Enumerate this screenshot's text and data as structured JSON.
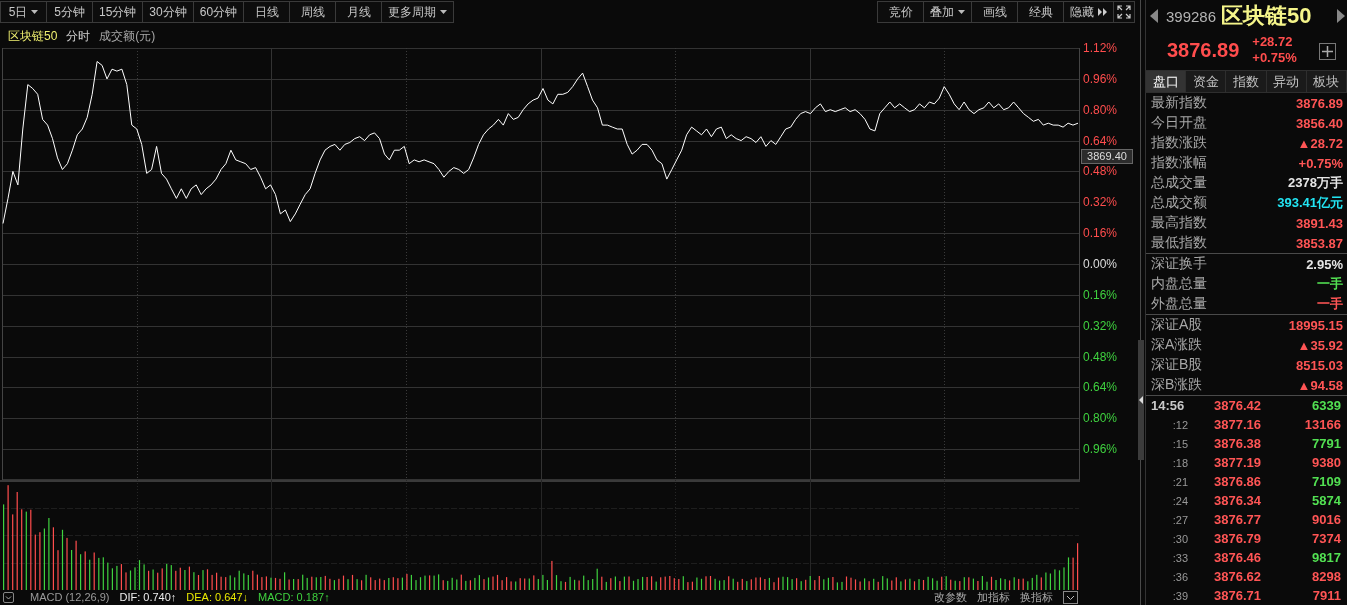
{
  "toolbar_left": [
    {
      "label": "5日",
      "kind": "dropdown",
      "selected": false
    },
    {
      "label": "5分钟",
      "kind": "button",
      "selected": false
    },
    {
      "label": "15分钟",
      "kind": "button",
      "selected": false
    },
    {
      "label": "30分钟",
      "kind": "button",
      "selected": false
    },
    {
      "label": "60分钟",
      "kind": "button",
      "selected": false
    },
    {
      "label": "日线",
      "kind": "button",
      "selected": false
    },
    {
      "label": "周线",
      "kind": "button",
      "selected": false
    },
    {
      "label": "月线",
      "kind": "button",
      "selected": false
    },
    {
      "label": "更多周期",
      "kind": "dropdown",
      "selected": false
    }
  ],
  "toolbar_right": [
    {
      "label": "竞价",
      "kind": "button"
    },
    {
      "label": "叠加",
      "kind": "dropdown"
    },
    {
      "label": "画线",
      "kind": "button"
    },
    {
      "label": "经典",
      "kind": "button"
    },
    {
      "label": "隐藏",
      "kind": "collapse"
    },
    {
      "kind": "fullscreen"
    }
  ],
  "legend": {
    "name": "区块链50",
    "period": "分时",
    "measure": "成交额(元)"
  },
  "chart": {
    "price_marker": "3869.40",
    "chart_data": {
      "type": "line",
      "grid": true,
      "ylim": [
        -1.12,
        1.12
      ],
      "yticks": [
        {
          "value": 1.12,
          "label": "1.12%"
        },
        {
          "value": 0.96,
          "label": "0.96%"
        },
        {
          "value": 0.8,
          "label": "0.80%"
        },
        {
          "value": 0.64,
          "label": "0.64%"
        },
        {
          "value": 0.48,
          "label": "0.48%"
        },
        {
          "value": 0.32,
          "label": "0.32%"
        },
        {
          "value": 0.16,
          "label": "0.16%"
        },
        {
          "value": 0,
          "label": "0.00%"
        },
        {
          "value": -0.16,
          "label": "0.16%"
        },
        {
          "value": -0.32,
          "label": "0.32%"
        },
        {
          "value": -0.48,
          "label": "0.48%"
        },
        {
          "value": -0.64,
          "label": "0.64%"
        },
        {
          "value": -0.8,
          "label": "0.80%"
        },
        {
          "value": -0.96,
          "label": "0.96%"
        }
      ],
      "values": [
        0.21,
        0.34,
        0.48,
        0.41,
        0.7,
        0.93,
        0.91,
        0.88,
        0.75,
        0.72,
        0.65,
        0.55,
        0.49,
        0.52,
        0.59,
        0.67,
        0.7,
        0.76,
        0.88,
        1.05,
        1.03,
        0.96,
        1.01,
        1.0,
        1.01,
        0.93,
        0.72,
        0.7,
        0.62,
        0.47,
        0.49,
        0.61,
        0.47,
        0.44,
        0.39,
        0.34,
        0.39,
        0.34,
        0.39,
        0.41,
        0.36,
        0.39,
        0.41,
        0.44,
        0.49,
        0.52,
        0.59,
        0.54,
        0.53,
        0.52,
        0.49,
        0.5,
        0.45,
        0.39,
        0.41,
        0.36,
        0.26,
        0.28,
        0.22,
        0.26,
        0.31,
        0.36,
        0.39,
        0.47,
        0.54,
        0.59,
        0.61,
        0.62,
        0.59,
        0.62,
        0.63,
        0.65,
        0.66,
        0.64,
        0.67,
        0.68,
        0.65,
        0.57,
        0.54,
        0.59,
        0.59,
        0.61,
        0.52,
        0.54,
        0.53,
        0.54,
        0.53,
        0.52,
        0.49,
        0.45,
        0.48,
        0.5,
        0.49,
        0.47,
        0.49,
        0.55,
        0.62,
        0.67,
        0.7,
        0.72,
        0.75,
        0.72,
        0.78,
        0.75,
        0.76,
        0.8,
        0.83,
        0.85,
        0.86,
        0.91,
        0.85,
        0.83,
        0.88,
        0.88,
        0.89,
        0.92,
        0.96,
        0.99,
        0.92,
        0.85,
        0.81,
        0.72,
        0.72,
        0.71,
        0.7,
        0.7,
        0.62,
        0.57,
        0.59,
        0.62,
        0.62,
        0.59,
        0.54,
        0.52,
        0.44,
        0.49,
        0.54,
        0.59,
        0.67,
        0.71,
        0.69,
        0.67,
        0.7,
        0.66,
        0.7,
        0.71,
        0.65,
        0.67,
        0.65,
        0.64,
        0.66,
        0.65,
        0.63,
        0.66,
        0.61,
        0.64,
        0.62,
        0.66,
        0.7,
        0.71,
        0.75,
        0.78,
        0.79,
        0.78,
        0.81,
        0.83,
        0.79,
        0.8,
        0.79,
        0.8,
        0.81,
        0.79,
        0.8,
        0.78,
        0.75,
        0.7,
        0.69,
        0.78,
        0.81,
        0.84,
        0.81,
        0.83,
        0.81,
        0.79,
        0.8,
        0.83,
        0.81,
        0.84,
        0.83,
        0.86,
        0.92,
        0.88,
        0.83,
        0.8,
        0.84,
        0.8,
        0.78,
        0.8,
        0.81,
        0.84,
        0.81,
        0.83,
        0.8,
        0.81,
        0.84,
        0.81,
        0.78,
        0.76,
        0.74,
        0.75,
        0.72,
        0.73,
        0.72,
        0.72,
        0.71,
        0.73,
        0.72,
        0.73
      ]
    }
  },
  "indicator_bar": {
    "name": "MACD (12,26,9)",
    "dif": "DIF: 0.740↑",
    "dea": "DEA: 0.647↓",
    "macd": "MACD: 0.187↑",
    "actions": [
      "改参数",
      "加指标",
      "换指标"
    ]
  },
  "quote": {
    "code": "399286",
    "name": "区块链50",
    "price": "3876.89",
    "change": "+28.72",
    "change_pct": "+0.75%"
  },
  "tabs": [
    {
      "label": "盘口",
      "selected": true
    },
    {
      "label": "资金",
      "selected": false
    },
    {
      "label": "指数",
      "selected": false
    },
    {
      "label": "异动",
      "selected": false
    },
    {
      "label": "板块",
      "selected": false
    }
  ],
  "stat_groups": [
    [
      {
        "label": "最新指数",
        "value": "3876.89",
        "color": "#ff5555"
      },
      {
        "label": "今日开盘",
        "value": "3856.40",
        "color": "#ff5555"
      },
      {
        "label": "指数涨跌",
        "value": "▲28.72",
        "color": "#ff5555"
      },
      {
        "label": "指数涨幅",
        "value": "+0.75%",
        "color": "#ff5555"
      },
      {
        "label": "总成交量",
        "value": "2378万手",
        "color": "#e6e6e6"
      },
      {
        "label": "总成交额",
        "value": "393.41亿元",
        "color": "#22e4f2"
      },
      {
        "label": "最高指数",
        "value": "3891.43",
        "color": "#ff5555"
      },
      {
        "label": "最低指数",
        "value": "3853.87",
        "color": "#ff5555"
      }
    ],
    [
      {
        "label": "深证换手",
        "value": "2.95%",
        "color": "#e6e6e6"
      },
      {
        "label": "内盘总量",
        "value": "一手",
        "color": "#52e052"
      },
      {
        "label": "外盘总量",
        "value": "一手",
        "color": "#ff5555"
      }
    ],
    [
      {
        "label": "深证A股",
        "value": "18995.15",
        "color": "#ff5555"
      },
      {
        "label": "深A涨跌",
        "value": "▲35.92",
        "color": "#ff5555"
      },
      {
        "label": "深证B股",
        "value": "8515.03",
        "color": "#ff5555"
      },
      {
        "label": "深B涨跌",
        "value": "▲94.58",
        "color": "#ff5555"
      }
    ]
  ],
  "ticks": [
    {
      "time": "14:56",
      "kind": "minute",
      "price": "3876.42",
      "volume": "6339",
      "color": "#52e052"
    },
    {
      "time": ":12",
      "kind": "second",
      "price": "3877.16",
      "volume": "13166",
      "color": "#ff5555"
    },
    {
      "time": ":15",
      "kind": "second",
      "price": "3876.38",
      "volume": "7791",
      "color": "#52e052"
    },
    {
      "time": ":18",
      "kind": "second",
      "price": "3877.19",
      "volume": "9380",
      "color": "#ff5555"
    },
    {
      "time": ":21",
      "kind": "second",
      "price": "3876.86",
      "volume": "7109",
      "color": "#52e052"
    },
    {
      "time": ":24",
      "kind": "second",
      "price": "3876.34",
      "volume": "5874",
      "color": "#52e052"
    },
    {
      "time": ":27",
      "kind": "second",
      "price": "3876.77",
      "volume": "9016",
      "color": "#ff5555"
    },
    {
      "time": ":30",
      "kind": "second",
      "price": "3876.79",
      "volume": "7374",
      "color": "#ff5555"
    },
    {
      "time": ":33",
      "kind": "second",
      "price": "3876.46",
      "volume": "9817",
      "color": "#52e052"
    },
    {
      "time": ":36",
      "kind": "second",
      "price": "3876.62",
      "volume": "8298",
      "color": "#ff5555"
    },
    {
      "time": ":39",
      "kind": "second",
      "price": "3876.71",
      "volume": "7911",
      "color": "#ff5555"
    }
  ]
}
